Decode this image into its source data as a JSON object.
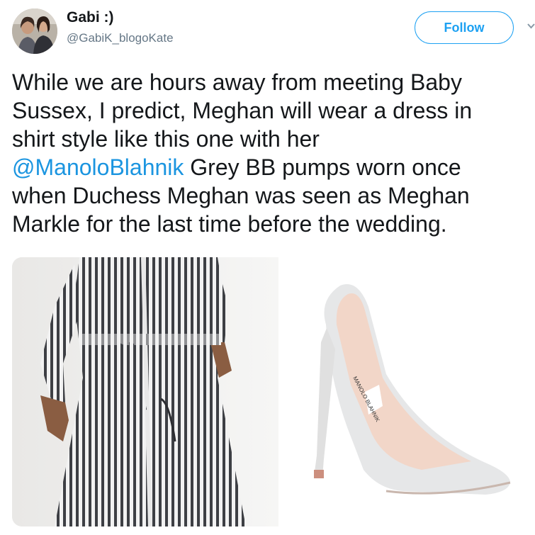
{
  "user": {
    "display_name": "Gabi :)",
    "handle": "@GabiK_blogoKate"
  },
  "follow_label": "Follow",
  "tweet": {
    "lines": [
      {
        "before": "While we are hours away from meeting Baby",
        "mention": "",
        "after": ""
      },
      {
        "before": "Sussex, I predict, Meghan will wear a dress in",
        "mention": "",
        "after": ""
      },
      {
        "before": "shirt style like this one with her",
        "mention": "",
        "after": ""
      },
      {
        "before": "",
        "mention": "@ManoloBlahnik",
        "after": " Grey BB pumps worn once"
      },
      {
        "before": "when Duchess Meghan was seen as Meghan",
        "mention": "",
        "after": ""
      },
      {
        "before": "Markle for the last time before the wedding.",
        "mention": "",
        "after": ""
      }
    ]
  },
  "media": {
    "left_photo": "striped-shirt-dress-photo",
    "right_photo": "grey-suede-pump-photo",
    "shoe_insole_text": "MANOLO BLAHNIK"
  },
  "colors": {
    "accent": "#1da1f2",
    "mention": "#1b95e0",
    "text": "#14171a",
    "secondary": "#657786"
  }
}
